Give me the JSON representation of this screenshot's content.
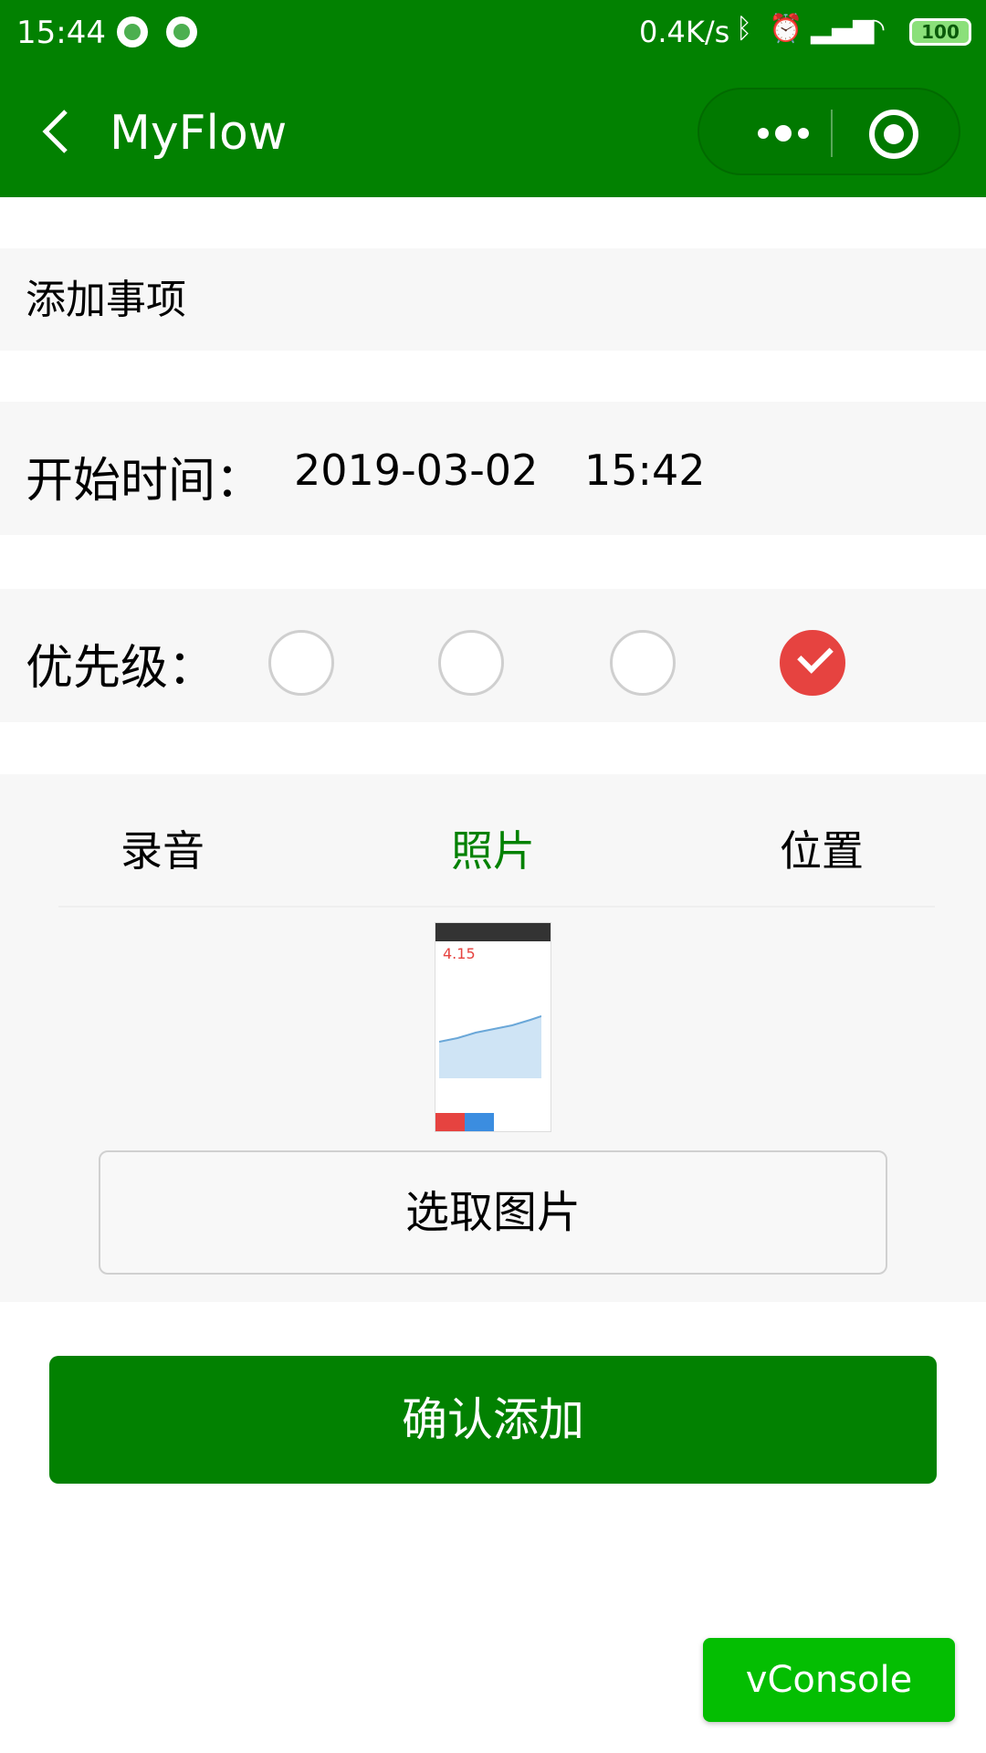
{
  "status_bar": {
    "time": "15:44",
    "network_speed": "0.4K/s",
    "battery": "100",
    "icons": [
      "notification-icon",
      "notification-icon",
      "bluetooth-icon",
      "alarm-icon",
      "signal-icon",
      "wifi-icon",
      "battery-icon"
    ]
  },
  "navbar": {
    "title": "MyFlow",
    "more_icon": "more-dots-icon",
    "target_icon": "target-icon"
  },
  "form": {
    "title_placeholder": "添加事项",
    "start_time_label": "开始时间：",
    "start_date": "2019-03-02",
    "start_time": "15:42",
    "priority_label": "优先级：",
    "priority_selected": 4,
    "tabs": [
      {
        "label": "录音",
        "active": false
      },
      {
        "label": "照片",
        "active": true
      },
      {
        "label": "位置",
        "active": false
      }
    ],
    "thumbnail_price": "4.15",
    "choose_image_button": "选取图片",
    "confirm_button": "确认添加"
  },
  "vconsole": {
    "label": "vConsole"
  },
  "colors": {
    "brand_green": "#028101",
    "check_red": "#e64340",
    "vconsole_green": "#04be02"
  }
}
